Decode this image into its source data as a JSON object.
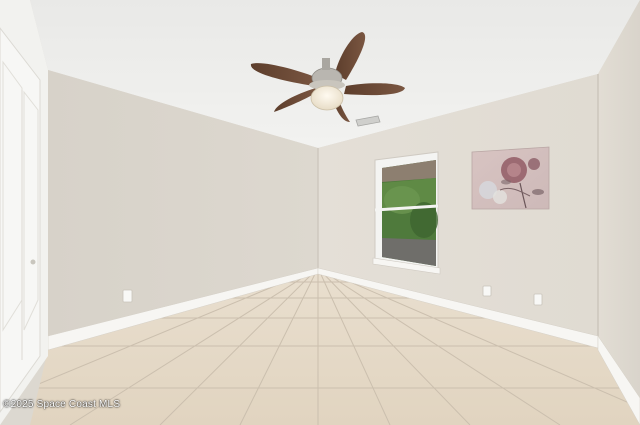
{
  "scene": {
    "description_type": "photo",
    "colors": {
      "ceiling": "#eeeeec",
      "wall_left": "#dcd7ce",
      "wall_back": "#e3ded6",
      "wall_right": "#e0dbd2",
      "floor": "#e4d8c6",
      "grout": "#cbbfae",
      "baseboard": "#f7f6f3",
      "door": "#f7f7f5",
      "fan_blade": "#6e4b36",
      "window_frame": "#f4f4f2",
      "foliage": "#4f7a3c",
      "art_bg": "#d9c7c4",
      "flower": "#9c6a72"
    }
  },
  "watermark": {
    "text": "©2025 Space Coast MLS"
  }
}
